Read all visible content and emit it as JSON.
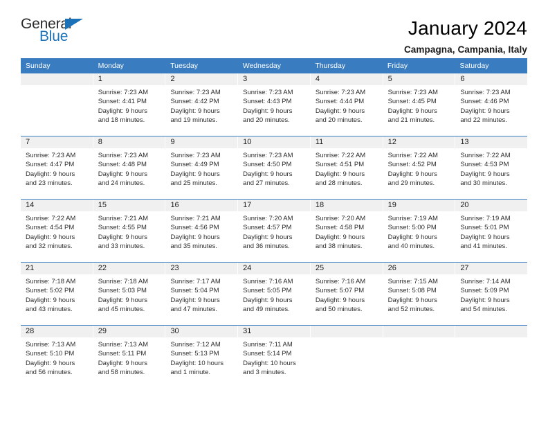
{
  "brand": {
    "name_part1": "General",
    "name_part2": "Blue",
    "accent_color": "#1c72b8"
  },
  "header": {
    "title": "January 2024",
    "subtitle": "Campagna, Campania, Italy"
  },
  "calendar": {
    "header_bg": "#3a7cc0",
    "daynum_bg": "#f0f0f0",
    "weekdays": [
      "Sunday",
      "Monday",
      "Tuesday",
      "Wednesday",
      "Thursday",
      "Friday",
      "Saturday"
    ],
    "weeks": [
      [
        {
          "day": "",
          "lines": []
        },
        {
          "day": "1",
          "lines": [
            "Sunrise: 7:23 AM",
            "Sunset: 4:41 PM",
            "Daylight: 9 hours",
            "and 18 minutes."
          ]
        },
        {
          "day": "2",
          "lines": [
            "Sunrise: 7:23 AM",
            "Sunset: 4:42 PM",
            "Daylight: 9 hours",
            "and 19 minutes."
          ]
        },
        {
          "day": "3",
          "lines": [
            "Sunrise: 7:23 AM",
            "Sunset: 4:43 PM",
            "Daylight: 9 hours",
            "and 20 minutes."
          ]
        },
        {
          "day": "4",
          "lines": [
            "Sunrise: 7:23 AM",
            "Sunset: 4:44 PM",
            "Daylight: 9 hours",
            "and 20 minutes."
          ]
        },
        {
          "day": "5",
          "lines": [
            "Sunrise: 7:23 AM",
            "Sunset: 4:45 PM",
            "Daylight: 9 hours",
            "and 21 minutes."
          ]
        },
        {
          "day": "6",
          "lines": [
            "Sunrise: 7:23 AM",
            "Sunset: 4:46 PM",
            "Daylight: 9 hours",
            "and 22 minutes."
          ]
        }
      ],
      [
        {
          "day": "7",
          "lines": [
            "Sunrise: 7:23 AM",
            "Sunset: 4:47 PM",
            "Daylight: 9 hours",
            "and 23 minutes."
          ]
        },
        {
          "day": "8",
          "lines": [
            "Sunrise: 7:23 AM",
            "Sunset: 4:48 PM",
            "Daylight: 9 hours",
            "and 24 minutes."
          ]
        },
        {
          "day": "9",
          "lines": [
            "Sunrise: 7:23 AM",
            "Sunset: 4:49 PM",
            "Daylight: 9 hours",
            "and 25 minutes."
          ]
        },
        {
          "day": "10",
          "lines": [
            "Sunrise: 7:23 AM",
            "Sunset: 4:50 PM",
            "Daylight: 9 hours",
            "and 27 minutes."
          ]
        },
        {
          "day": "11",
          "lines": [
            "Sunrise: 7:22 AM",
            "Sunset: 4:51 PM",
            "Daylight: 9 hours",
            "and 28 minutes."
          ]
        },
        {
          "day": "12",
          "lines": [
            "Sunrise: 7:22 AM",
            "Sunset: 4:52 PM",
            "Daylight: 9 hours",
            "and 29 minutes."
          ]
        },
        {
          "day": "13",
          "lines": [
            "Sunrise: 7:22 AM",
            "Sunset: 4:53 PM",
            "Daylight: 9 hours",
            "and 30 minutes."
          ]
        }
      ],
      [
        {
          "day": "14",
          "lines": [
            "Sunrise: 7:22 AM",
            "Sunset: 4:54 PM",
            "Daylight: 9 hours",
            "and 32 minutes."
          ]
        },
        {
          "day": "15",
          "lines": [
            "Sunrise: 7:21 AM",
            "Sunset: 4:55 PM",
            "Daylight: 9 hours",
            "and 33 minutes."
          ]
        },
        {
          "day": "16",
          "lines": [
            "Sunrise: 7:21 AM",
            "Sunset: 4:56 PM",
            "Daylight: 9 hours",
            "and 35 minutes."
          ]
        },
        {
          "day": "17",
          "lines": [
            "Sunrise: 7:20 AM",
            "Sunset: 4:57 PM",
            "Daylight: 9 hours",
            "and 36 minutes."
          ]
        },
        {
          "day": "18",
          "lines": [
            "Sunrise: 7:20 AM",
            "Sunset: 4:58 PM",
            "Daylight: 9 hours",
            "and 38 minutes."
          ]
        },
        {
          "day": "19",
          "lines": [
            "Sunrise: 7:19 AM",
            "Sunset: 5:00 PM",
            "Daylight: 9 hours",
            "and 40 minutes."
          ]
        },
        {
          "day": "20",
          "lines": [
            "Sunrise: 7:19 AM",
            "Sunset: 5:01 PM",
            "Daylight: 9 hours",
            "and 41 minutes."
          ]
        }
      ],
      [
        {
          "day": "21",
          "lines": [
            "Sunrise: 7:18 AM",
            "Sunset: 5:02 PM",
            "Daylight: 9 hours",
            "and 43 minutes."
          ]
        },
        {
          "day": "22",
          "lines": [
            "Sunrise: 7:18 AM",
            "Sunset: 5:03 PM",
            "Daylight: 9 hours",
            "and 45 minutes."
          ]
        },
        {
          "day": "23",
          "lines": [
            "Sunrise: 7:17 AM",
            "Sunset: 5:04 PM",
            "Daylight: 9 hours",
            "and 47 minutes."
          ]
        },
        {
          "day": "24",
          "lines": [
            "Sunrise: 7:16 AM",
            "Sunset: 5:05 PM",
            "Daylight: 9 hours",
            "and 49 minutes."
          ]
        },
        {
          "day": "25",
          "lines": [
            "Sunrise: 7:16 AM",
            "Sunset: 5:07 PM",
            "Daylight: 9 hours",
            "and 50 minutes."
          ]
        },
        {
          "day": "26",
          "lines": [
            "Sunrise: 7:15 AM",
            "Sunset: 5:08 PM",
            "Daylight: 9 hours",
            "and 52 minutes."
          ]
        },
        {
          "day": "27",
          "lines": [
            "Sunrise: 7:14 AM",
            "Sunset: 5:09 PM",
            "Daylight: 9 hours",
            "and 54 minutes."
          ]
        }
      ],
      [
        {
          "day": "28",
          "lines": [
            "Sunrise: 7:13 AM",
            "Sunset: 5:10 PM",
            "Daylight: 9 hours",
            "and 56 minutes."
          ]
        },
        {
          "day": "29",
          "lines": [
            "Sunrise: 7:13 AM",
            "Sunset: 5:11 PM",
            "Daylight: 9 hours",
            "and 58 minutes."
          ]
        },
        {
          "day": "30",
          "lines": [
            "Sunrise: 7:12 AM",
            "Sunset: 5:13 PM",
            "Daylight: 10 hours",
            "and 1 minute."
          ]
        },
        {
          "day": "31",
          "lines": [
            "Sunrise: 7:11 AM",
            "Sunset: 5:14 PM",
            "Daylight: 10 hours",
            "and 3 minutes."
          ]
        },
        {
          "day": "",
          "lines": []
        },
        {
          "day": "",
          "lines": []
        },
        {
          "day": "",
          "lines": []
        }
      ]
    ]
  }
}
